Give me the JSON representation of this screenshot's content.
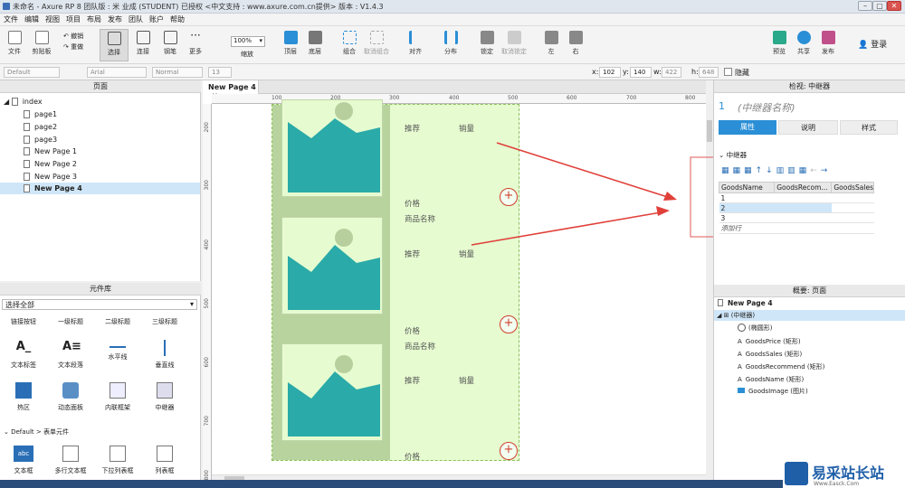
{
  "window": {
    "title": "未命名 - Axure RP 8 团队版 : 米 业成 (STUDENT) 已授权    <中文支持 : www.axure.com.cn提供> 版本 : V1.4.3",
    "min": "–",
    "max": "▢",
    "close": "✕"
  },
  "menu": [
    "文件",
    "编辑",
    "视图",
    "项目",
    "布局",
    "发布",
    "团队",
    "账户",
    "帮助"
  ],
  "toolbar": {
    "file": "文件",
    "clipboard": "剪贴板",
    "undo": "撤销",
    "redo": "重做",
    "select": "选择",
    "connect": "连接",
    "pen": "钢笔",
    "more": "更多",
    "zoom_value": "100%",
    "zoom": "缩放",
    "top": "顶层",
    "bottom": "底层",
    "group": "组合",
    "ungroup": "取消组合",
    "align": "对齐",
    "distribute": "分布",
    "lock": "锁定",
    "unlock": "取消锁定",
    "left": "左",
    "right": "右",
    "preview": "预览",
    "share": "共享",
    "publish": "发布",
    "login": "登录"
  },
  "format": {
    "style": "Default",
    "font": "Arial",
    "weight": "Normal",
    "size": "13",
    "x_label": "x:",
    "x": "102",
    "y_label": "y:",
    "y": "140",
    "w_label": "w:",
    "w": "422",
    "h_label": "h:",
    "h": "648",
    "hidden": "隐藏"
  },
  "pages": {
    "header": "页面",
    "root": "index",
    "items": [
      "page1",
      "page2",
      "page3",
      "New Page 1",
      "New Page 2",
      "New Page 3",
      "New Page 4"
    ]
  },
  "library": {
    "header": "元件库",
    "select": "选择全部",
    "row1": [
      "链接按钮",
      "一级标题",
      "二级标题",
      "三级标题"
    ],
    "row2": [
      "文本标签",
      "文本段落",
      "水平线",
      "垂直线"
    ],
    "row3": [
      "热区",
      "动态面板",
      "内联框架",
      "中继器"
    ],
    "section": "Default > 表单元件",
    "row4": [
      "文本框",
      "多行文本框",
      "下拉列表框",
      "列表框"
    ],
    "row4_icon": "abc"
  },
  "canvas": {
    "tab": "New Page 4",
    "tab_close": "×",
    "ruler_h": [
      "100",
      "200",
      "300",
      "400",
      "500",
      "600",
      "700",
      "800"
    ],
    "ruler_v": [
      "200",
      "300",
      "400",
      "500",
      "600",
      "700",
      "800"
    ],
    "recommend": "推荐",
    "sales": "销量",
    "price": "价格",
    "goods_name": "商品名称",
    "plus": "+"
  },
  "inspector": {
    "header": "检视: 中继器",
    "index": "1",
    "name": "(中继器名称)",
    "tabs": [
      "属性",
      "说明",
      "样式"
    ],
    "section": "中继器",
    "columns": [
      "GoodsName",
      "GoodsRecom...",
      "GoodsSales"
    ],
    "rows": [
      "1",
      "2",
      "3"
    ],
    "add_row": "添加行"
  },
  "outline": {
    "header": "概要: 页面",
    "page": "New Page 4",
    "repeater": "(中继器)",
    "items": [
      "(椭圆形)",
      "GoodsPrice (矩形)",
      "GoodsSales (矩形)",
      "GoodsRecommend (矩形)",
      "GoodsName (矩形)",
      "GoodsImage (图片)"
    ],
    "text_prefix": "A"
  },
  "watermark": {
    "title": "易采站长站",
    "sub": "Www.Easck.Com"
  },
  "colors": {
    "accent": "#2a8fd6",
    "teal": "#2aaaa8",
    "arrow": "#e0403a",
    "repeater_bg": "#e6fbd0"
  }
}
